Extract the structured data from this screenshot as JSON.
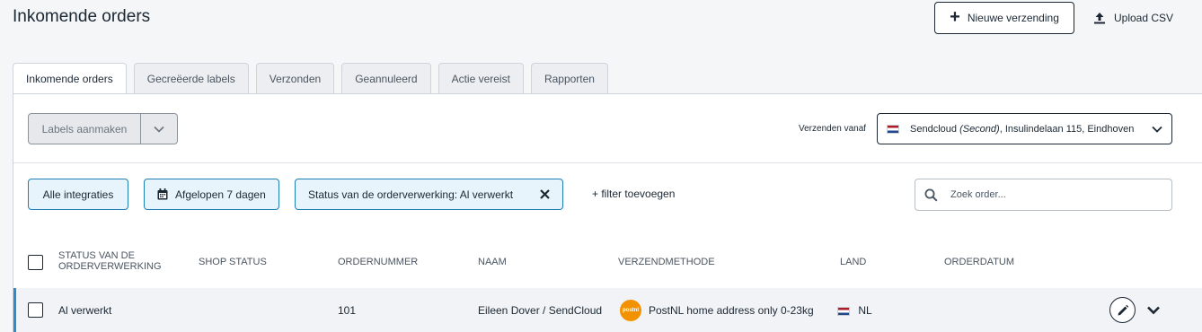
{
  "header": {
    "title": "Inkomende orders",
    "new_shipment_label": "Nieuwe verzending",
    "upload_csv_label": "Upload CSV"
  },
  "tabs": [
    {
      "label": "Inkomende orders",
      "active": true
    },
    {
      "label": "Gecreëerde labels",
      "active": false
    },
    {
      "label": "Verzonden",
      "active": false
    },
    {
      "label": "Geannuleerd",
      "active": false
    },
    {
      "label": "Actie vereist",
      "active": false
    },
    {
      "label": "Rapporten",
      "active": false
    }
  ],
  "toolbar": {
    "create_labels_label": "Labels aanmaken",
    "ship_from_label": "Verzenden vanaf",
    "ship_from_name": "Sendcloud",
    "ship_from_italic": "(Second)",
    "ship_from_address": ", Insulindelaan 115, Eindhoven"
  },
  "filters": {
    "integrations": "Alle integraties",
    "period": "Afgelopen 7 dagen",
    "status": "Status van de orderverwerking: Al verwerkt",
    "add_filter": "+ filter toevoegen",
    "search_placeholder": "Zoek order..."
  },
  "table": {
    "columns": {
      "processing_status": "STATUS VAN DE ORDERVERWERKING",
      "shop_status": "SHOP STATUS",
      "order_number": "ORDERNUMMER",
      "name": "NAAM",
      "shipping_method": "VERZENDMETHODE",
      "country": "LAND",
      "order_date": "ORDERDATUM"
    },
    "rows": [
      {
        "processing_status": "Al verwerkt",
        "order_number": "101",
        "name": "Eileen Dover / SendCloud",
        "shipping_method": "PostNL home address only 0-23kg",
        "carrier_logo_text": "postnl",
        "country": "NL"
      }
    ]
  },
  "colors": {
    "accent": "#1e7fb5",
    "chip_bg": "#e7f4fb",
    "row_highlight": "#2a8ccc",
    "postnl": "#f39200"
  },
  "icons": {
    "new_shipment": "plus-icon",
    "upload": "upload-icon",
    "dropdown": "chevron-down-icon",
    "calendar": "calendar-icon",
    "close": "close-icon",
    "search": "search-icon",
    "edit": "pencil-icon",
    "flag": "netherlands-flag-icon"
  }
}
